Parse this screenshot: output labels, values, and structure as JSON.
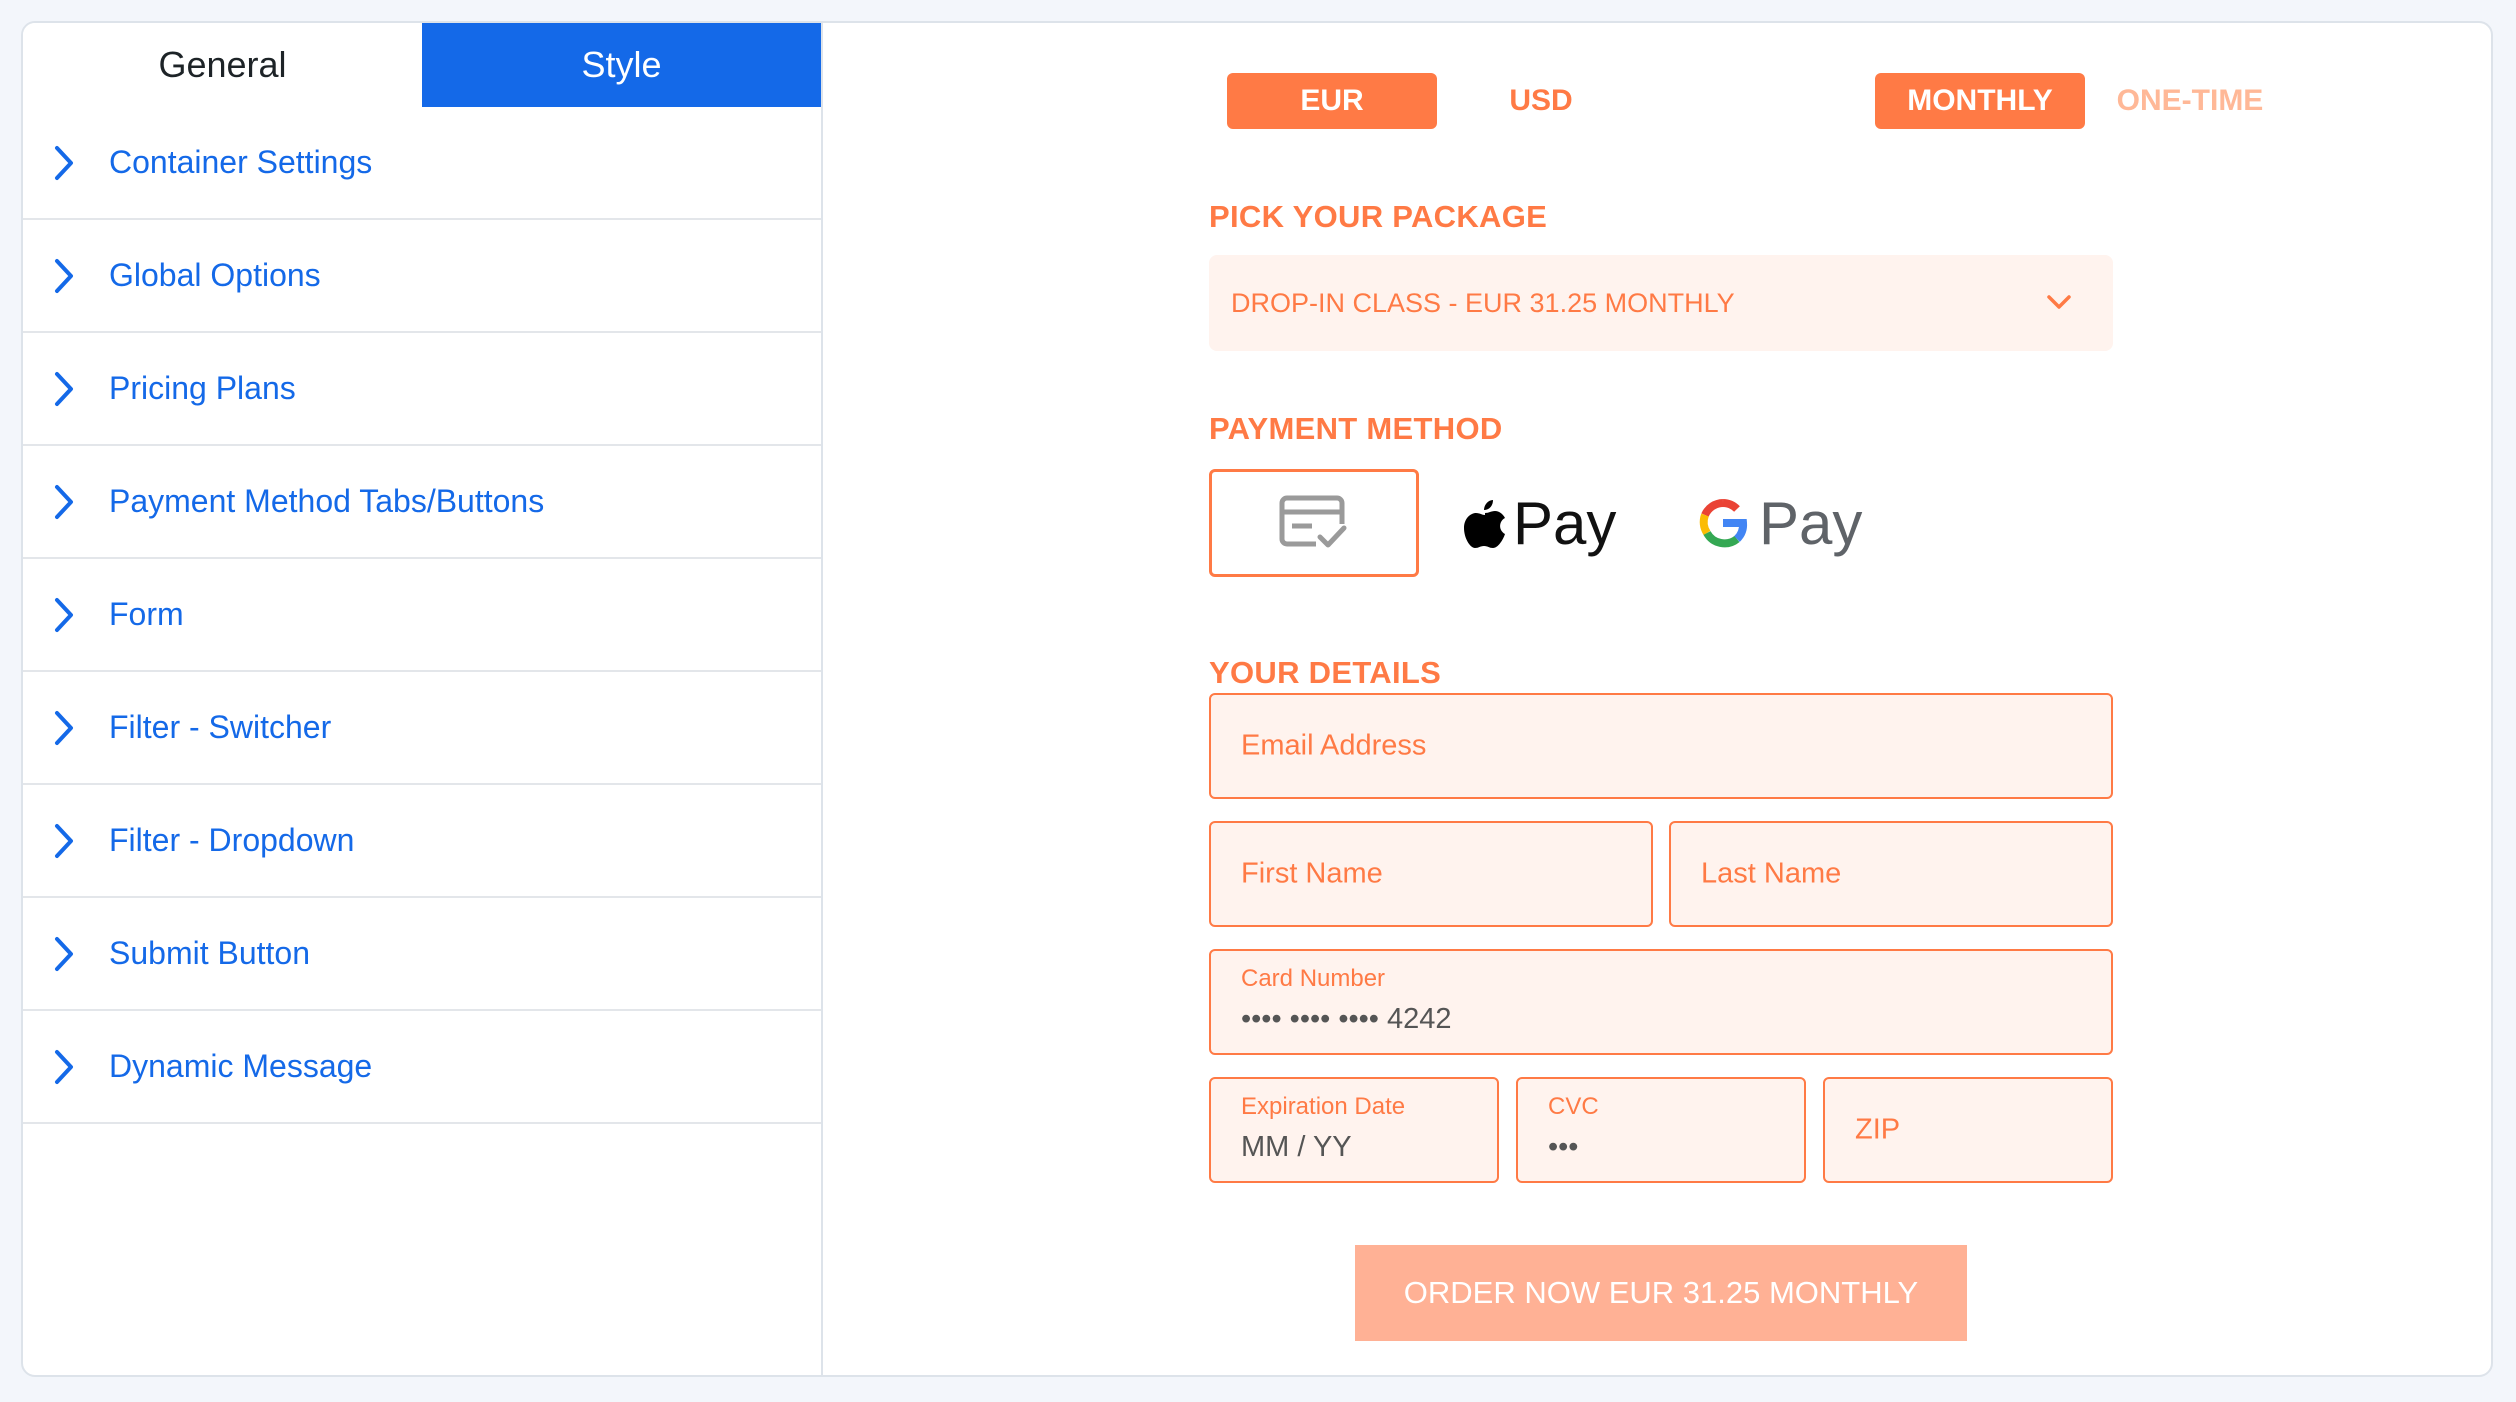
{
  "tabs": {
    "general": "General",
    "style": "Style"
  },
  "sections": [
    {
      "label": "Container Settings"
    },
    {
      "label": "Global Options"
    },
    {
      "label": "Pricing Plans"
    },
    {
      "label": "Payment Method Tabs/Buttons"
    },
    {
      "label": "Form"
    },
    {
      "label": "Filter - Switcher"
    },
    {
      "label": "Filter - Dropdown"
    },
    {
      "label": "Submit Button"
    },
    {
      "label": "Dynamic Message"
    }
  ],
  "currency": {
    "eur": "EUR",
    "usd": "USD",
    "selected": "EUR"
  },
  "frequency": {
    "monthly": "MONTHLY",
    "one_time": "ONE-TIME",
    "selected": "MONTHLY"
  },
  "package": {
    "heading": "PICK YOUR PACKAGE",
    "selected": "DROP-IN CLASS - EUR 31.25 MONTHLY"
  },
  "payment": {
    "heading": "PAYMENT METHOD",
    "apple_pay_label": "Pay",
    "google_pay_label": "Pay",
    "icons": [
      "credit-card-icon",
      "apple-logo-icon",
      "google-g-icon"
    ]
  },
  "details": {
    "heading": "YOUR DETAILS",
    "email_placeholder": "Email Address",
    "first_name_placeholder": "First Name",
    "last_name_placeholder": "Last Name",
    "card_number_label": "Card Number",
    "card_number_value": "•••• •••• •••• 4242",
    "expiration_label": "Expiration Date",
    "expiration_value": "MM / YY",
    "cvc_label": "CVC",
    "cvc_value": "•••",
    "zip_placeholder": "ZIP"
  },
  "submit": {
    "label": "ORDER NOW EUR 31.25 MONTHLY"
  },
  "colors": {
    "accent_blue": "#1469e8",
    "accent_orange": "#ff7a45",
    "field_bg": "#fff3ee",
    "submit_bg": "#ffb195"
  }
}
